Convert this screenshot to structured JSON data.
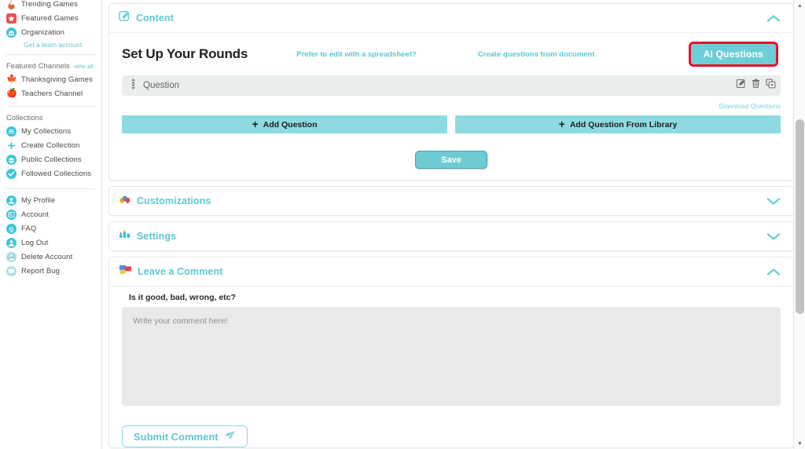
{
  "sidebar": {
    "top_items": [
      {
        "label": "Trending Games",
        "icon": "flame-icon"
      },
      {
        "label": "Featured Games",
        "icon": "star-icon"
      },
      {
        "label": "Organization",
        "icon": "organization-icon"
      }
    ],
    "organization_sublink": "Get a team account",
    "featured_channels": {
      "heading": "Featured Channels",
      "view_all": "view all",
      "items": [
        {
          "label": "Thanksgiving Games",
          "icon": "maple-leaf-icon"
        },
        {
          "label": "Teachers Channel",
          "icon": "apple-icon"
        }
      ]
    },
    "collections": {
      "heading": "Collections",
      "items": [
        {
          "label": "My Collections",
          "icon": "list-circle-icon"
        },
        {
          "label": "Create Collection",
          "icon": "plus-icon"
        },
        {
          "label": "Public Collections",
          "icon": "globe-icon"
        },
        {
          "label": "Followed Collections",
          "icon": "check-circle-icon"
        }
      ]
    },
    "account_items": [
      {
        "label": "My Profile",
        "icon": "person-icon"
      },
      {
        "label": "Account",
        "icon": "account-card-icon"
      },
      {
        "label": "FAQ",
        "icon": "question-circle-icon"
      },
      {
        "label": "Log Out",
        "icon": "person-icon"
      },
      {
        "label": "Delete Account",
        "icon": "delete-account-icon"
      },
      {
        "label": "Report Bug",
        "icon": "chat-bubble-icon"
      }
    ]
  },
  "content_section": {
    "title": "Content",
    "icon": "edit-square-icon",
    "collapse_icon": "chevron-up-icon",
    "heading": "Set Up Your Rounds",
    "spreadsheet_link": "Prefer to edit with a spreadsheet?",
    "document_link": "Create questions from document",
    "ai_button": "AI Questions",
    "question_row": {
      "label": "Question",
      "drag_icon": "drag-handle-icon",
      "edit_icon": "edit-icon",
      "delete_icon": "trash-icon",
      "duplicate_icon": "duplicate-icon"
    },
    "download_link": "Download Questions",
    "add_question": "Add Question",
    "add_question_library": "Add Question From Library",
    "save_button": "Save"
  },
  "customizations_section": {
    "title": "Customizations",
    "icon": "paint-drops-icon",
    "collapse_icon": "chevron-down-icon"
  },
  "settings_section": {
    "title": "Settings",
    "icon": "sliders-icon",
    "collapse_icon": "chevron-down-icon"
  },
  "comment_section": {
    "title": "Leave a Comment",
    "icon": "comment-bubbles-icon",
    "collapse_icon": "chevron-up-icon",
    "prompt": "Is it good, bad, wrong, etc?",
    "placeholder": "Write your comment here!",
    "value": "",
    "submit_button": "Submit Comment",
    "submit_icon": "send-icon"
  },
  "colors": {
    "accent_teal": "#5ec8d0",
    "button_teal": "#6ccfd8",
    "add_button_teal": "#8ddbe0",
    "highlight_red": "#e8112d",
    "question_bar_gray": "#e9edee",
    "textarea_gray": "#e9e9e9"
  }
}
